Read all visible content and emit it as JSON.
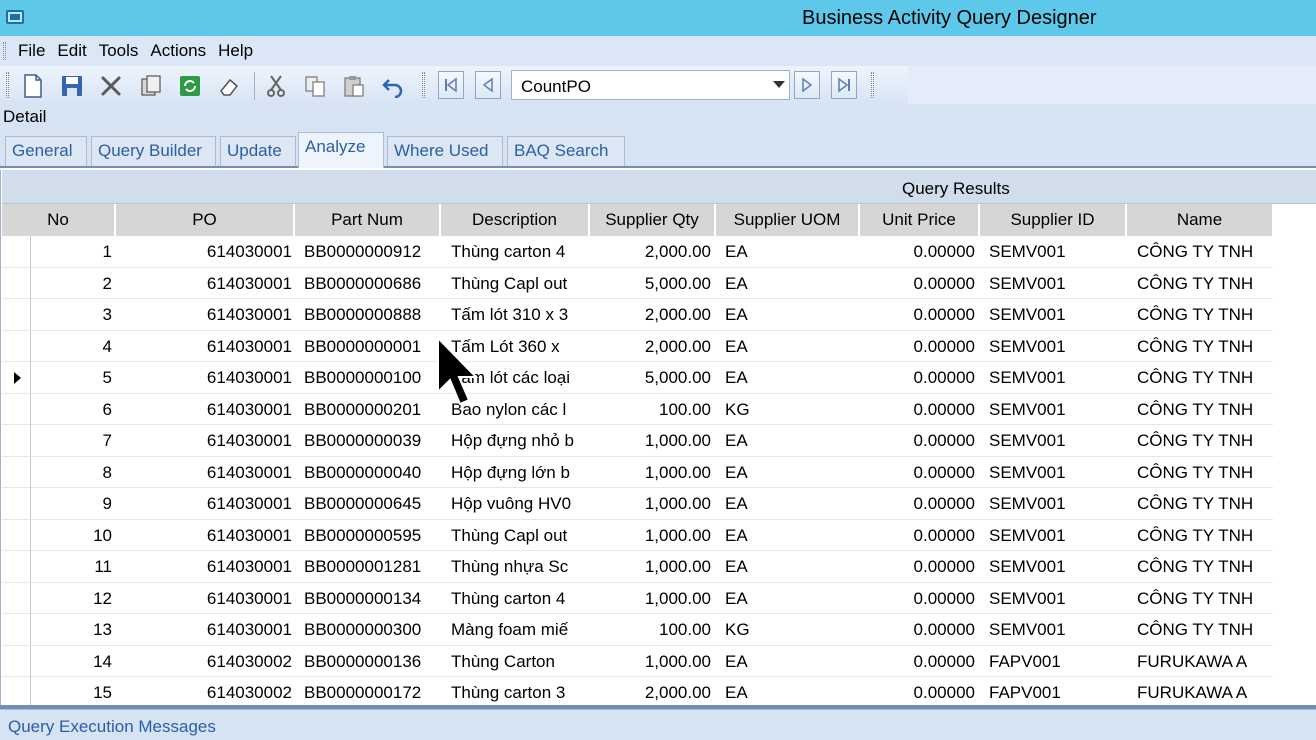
{
  "window": {
    "title": "Business Activity Query Designer"
  },
  "menu": [
    "File",
    "Edit",
    "Tools",
    "Actions",
    "Help"
  ],
  "toolbar": {
    "icons": [
      "new-icon",
      "save-icon",
      "delete-icon",
      "copy-icon",
      "refresh-icon",
      "clear-icon",
      "cut-icon",
      "copy-clip-icon",
      "paste-icon",
      "undo-icon"
    ],
    "query_combo_value": "CountPO"
  },
  "detail_label": "Detail",
  "tabs": [
    "General",
    "Query Builder",
    "Update",
    "Analyze",
    "Where Used",
    "BAQ Search"
  ],
  "active_tab": "Analyze",
  "grid": {
    "caption": "Query Results",
    "columns": [
      "No",
      "PO",
      "Part Num",
      "Description",
      "Supplier Qty",
      "Supplier UOM",
      "Unit Price",
      "Supplier ID",
      "Name"
    ],
    "selected_row": 5,
    "rows": [
      [
        "1",
        "614030001",
        "BB0000000912",
        "Thùng carton 4",
        "2,000.00",
        "EA",
        "0.00000",
        "SEMV001",
        "CÔNG TY TNH"
      ],
      [
        "2",
        "614030001",
        "BB0000000686",
        "Thùng Capl out",
        "5,000.00",
        "EA",
        "0.00000",
        "SEMV001",
        "CÔNG TY TNH"
      ],
      [
        "3",
        "614030001",
        "BB0000000888",
        "Tấm lót 310 x 3",
        "2,000.00",
        "EA",
        "0.00000",
        "SEMV001",
        "CÔNG TY TNH"
      ],
      [
        "4",
        "614030001",
        "BB0000000001",
        "Tấm Lót 360 x",
        "2,000.00",
        "EA",
        "0.00000",
        "SEMV001",
        "CÔNG TY TNH"
      ],
      [
        "5",
        "614030001",
        "BB0000000100",
        "Tấm lót các loại",
        "5,000.00",
        "EA",
        "0.00000",
        "SEMV001",
        "CÔNG TY TNH"
      ],
      [
        "6",
        "614030001",
        "BB0000000201",
        "Bao nylon các l",
        "100.00",
        "KG",
        "0.00000",
        "SEMV001",
        "CÔNG TY TNH"
      ],
      [
        "7",
        "614030001",
        "BB0000000039",
        "Hộp đựng nhỏ b",
        "1,000.00",
        "EA",
        "0.00000",
        "SEMV001",
        "CÔNG TY TNH"
      ],
      [
        "8",
        "614030001",
        "BB0000000040",
        "Hộp đựng lớn b",
        "1,000.00",
        "EA",
        "0.00000",
        "SEMV001",
        "CÔNG TY TNH"
      ],
      [
        "9",
        "614030001",
        "BB0000000645",
        "Hộp vuông HV0",
        "1,000.00",
        "EA",
        "0.00000",
        "SEMV001",
        "CÔNG TY TNH"
      ],
      [
        "10",
        "614030001",
        "BB0000000595",
        "Thùng Capl out",
        "1,000.00",
        "EA",
        "0.00000",
        "SEMV001",
        "CÔNG TY TNH"
      ],
      [
        "11",
        "614030001",
        "BB0000001281",
        "Thùng nhựa Sc",
        "1,000.00",
        "EA",
        "0.00000",
        "SEMV001",
        "CÔNG TY TNH"
      ],
      [
        "12",
        "614030001",
        "BB0000000134",
        "Thùng carton  4",
        "1,000.00",
        "EA",
        "0.00000",
        "SEMV001",
        "CÔNG TY TNH"
      ],
      [
        "13",
        "614030001",
        "BB0000000300",
        "Màng foam miế",
        "100.00",
        "KG",
        "0.00000",
        "SEMV001",
        "CÔNG TY TNH"
      ],
      [
        "14",
        "614030002",
        "BB0000000136",
        "Thùng Carton",
        "1,000.00",
        "EA",
        "0.00000",
        "FAPV001",
        "FURUKAWA A"
      ],
      [
        "15",
        "614030002",
        "BB0000000172",
        "Thùng carton 3",
        "2,000.00",
        "EA",
        "0.00000",
        "FAPV001",
        "FURUKAWA A"
      ]
    ]
  },
  "status_panel": "Query Execution Messages",
  "colors": {
    "titlebar": "#5ec8ea",
    "menubar": "#dbe7f6",
    "tab_text": "#2a5ea8",
    "header_gray": "#d6d6d6"
  }
}
